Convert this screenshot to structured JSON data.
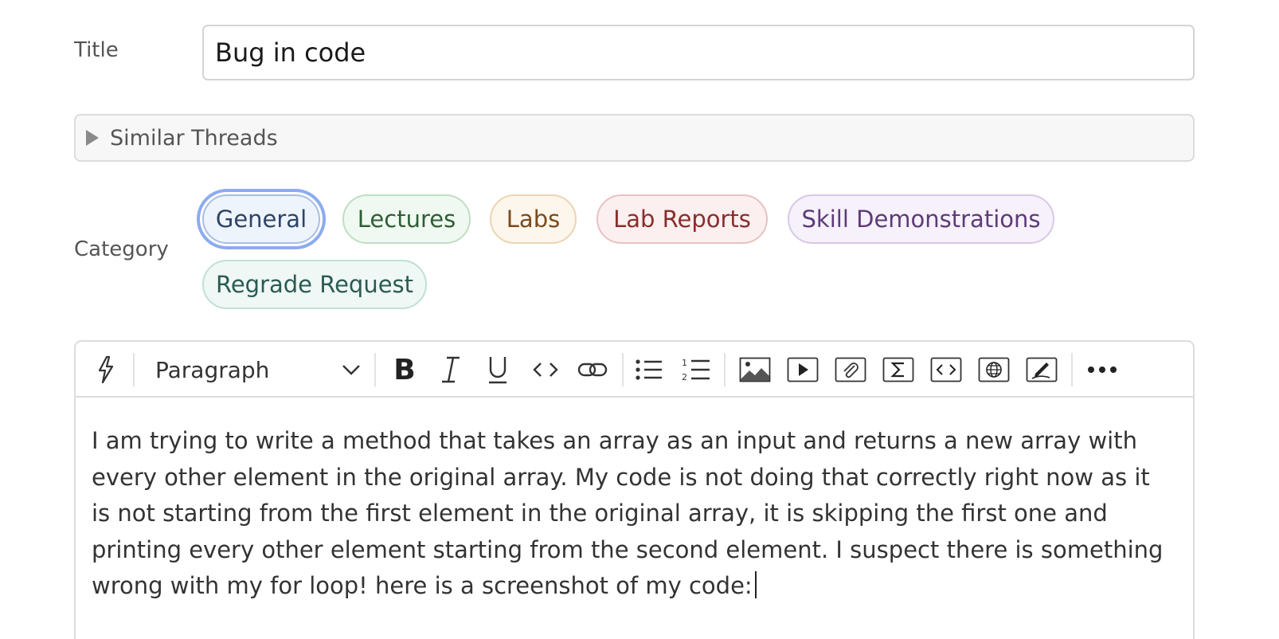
{
  "form": {
    "title_label": "Title",
    "title_value": "Bug in code",
    "similar_threads_label": "Similar Threads",
    "category_label": "Category"
  },
  "categories": [
    {
      "label": "General",
      "selected": true,
      "text_color": "#2d4467",
      "bg": "#eef4fc",
      "border": "#a9bfe0"
    },
    {
      "label": "Lectures",
      "selected": false,
      "text_color": "#2f5e34",
      "bg": "#f0f9f1",
      "border": "#bfdec3"
    },
    {
      "label": "Labs",
      "selected": false,
      "text_color": "#7a4b1d",
      "bg": "#fdf6ec",
      "border": "#ecd4b3"
    },
    {
      "label": "Lab Reports",
      "selected": false,
      "text_color": "#8a2d2d",
      "bg": "#fcefef",
      "border": "#e9c1c1"
    },
    {
      "label": "Skill Demonstrations",
      "selected": false,
      "text_color": "#5d3b78",
      "bg": "#f6f1fb",
      "border": "#d8c8e6"
    },
    {
      "label": "Regrade Request",
      "selected": false,
      "text_color": "#2b5b52",
      "bg": "#eff8f5",
      "border": "#bfe0d6"
    }
  ],
  "editor": {
    "toolbar": {
      "block_style": "Paragraph",
      "icons": [
        "lightning-icon",
        "bold-icon",
        "italic-icon",
        "underline-icon",
        "inline-code-icon",
        "link-icon",
        "bullet-list-icon",
        "numbered-list-icon",
        "image-icon",
        "video-icon",
        "attachment-icon",
        "math-icon",
        "code-block-icon",
        "web-embed-icon",
        "drawing-icon",
        "more-icon"
      ]
    },
    "body_text": "I am trying to write a method that takes an array as an input and returns a new array with every other element in the original array. My code is not doing that correctly right now as it is not starting from the first element in the original array, it is skipping the first one and printing every other element starting from the second element. I suspect there is something wrong with my for loop! here is a screenshot of my code:"
  }
}
